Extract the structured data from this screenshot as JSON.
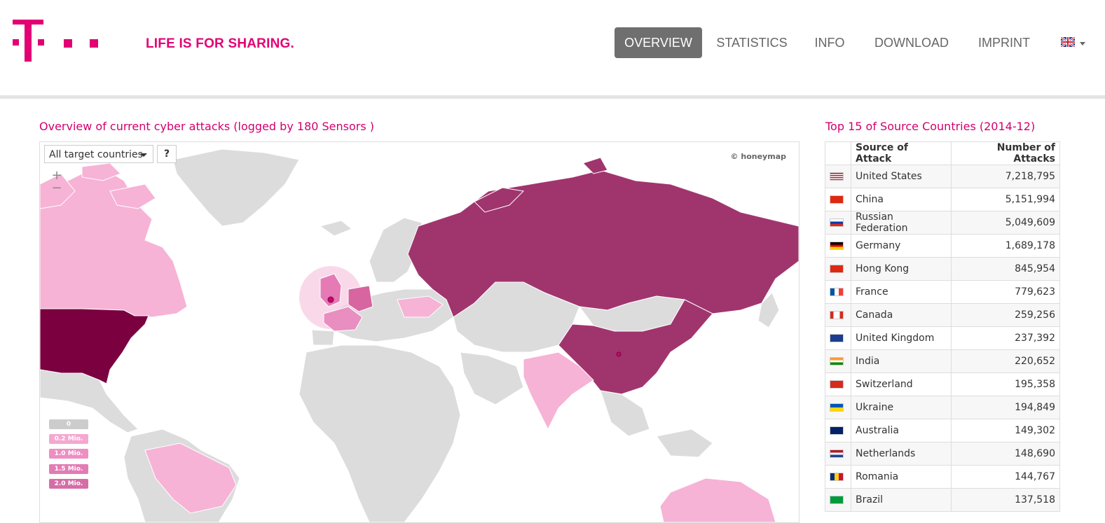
{
  "header": {
    "tagline": "LIFE IS FOR SHARING.",
    "nav": [
      {
        "label": "OVERVIEW",
        "active": true
      },
      {
        "label": "STATISTICS",
        "active": false
      },
      {
        "label": "INFO",
        "active": false
      },
      {
        "label": "DOWNLOAD",
        "active": false
      },
      {
        "label": "IMPRINT",
        "active": false
      }
    ],
    "language_icon": "uk-flag-icon"
  },
  "map_section": {
    "title": "Overview of current cyber attacks (logged by 180 Sensors )",
    "target_filter": "All target countries",
    "help_label": "?",
    "zoom_in": "+",
    "zoom_out": "−",
    "copyright": "© honeymap",
    "legend": [
      {
        "label": "0",
        "color": "#cccccc"
      },
      {
        "label": "0.2 Mio.",
        "color": "#f4a8d0"
      },
      {
        "label": "1.0 Mio.",
        "color": "#ee8ec2"
      },
      {
        "label": "1.5 Mio.",
        "color": "#e27cb4"
      },
      {
        "label": "2.0 Mio.",
        "color": "#d56ea7"
      }
    ]
  },
  "top_countries": {
    "title": "Top 15 of Source Countries (2014-12)",
    "headers": {
      "source": "Source of Attack",
      "count": "Number of Attacks"
    },
    "rows": [
      {
        "country": "United States",
        "attacks": "7,218,795",
        "flag": "us-flag-icon"
      },
      {
        "country": "China",
        "attacks": "5,151,994",
        "flag": "cn-flag-icon"
      },
      {
        "country": "Russian Federation",
        "attacks": "5,049,609",
        "flag": "ru-flag-icon"
      },
      {
        "country": "Germany",
        "attacks": "1,689,178",
        "flag": "de-flag-icon"
      },
      {
        "country": "Hong Kong",
        "attacks": "845,954",
        "flag": "hk-flag-icon"
      },
      {
        "country": "France",
        "attacks": "779,623",
        "flag": "fr-flag-icon"
      },
      {
        "country": "Canada",
        "attacks": "259,256",
        "flag": "ca-flag-icon"
      },
      {
        "country": "United Kingdom",
        "attacks": "237,392",
        "flag": "gb-flag-icon"
      },
      {
        "country": "India",
        "attacks": "220,652",
        "flag": "in-flag-icon"
      },
      {
        "country": "Switzerland",
        "attacks": "195,358",
        "flag": "ch-flag-icon"
      },
      {
        "country": "Ukraine",
        "attacks": "194,849",
        "flag": "ua-flag-icon"
      },
      {
        "country": "Australia",
        "attacks": "149,302",
        "flag": "au-flag-icon"
      },
      {
        "country": "Netherlands",
        "attacks": "148,690",
        "flag": "nl-flag-icon"
      },
      {
        "country": "Romania",
        "attacks": "144,767",
        "flag": "ro-flag-icon"
      },
      {
        "country": "Brazil",
        "attacks": "137,518",
        "flag": "br-flag-icon"
      }
    ]
  },
  "colors": {
    "brand": "#e20074",
    "title": "#d2006e",
    "nav_active": "#6f6f6f"
  }
}
